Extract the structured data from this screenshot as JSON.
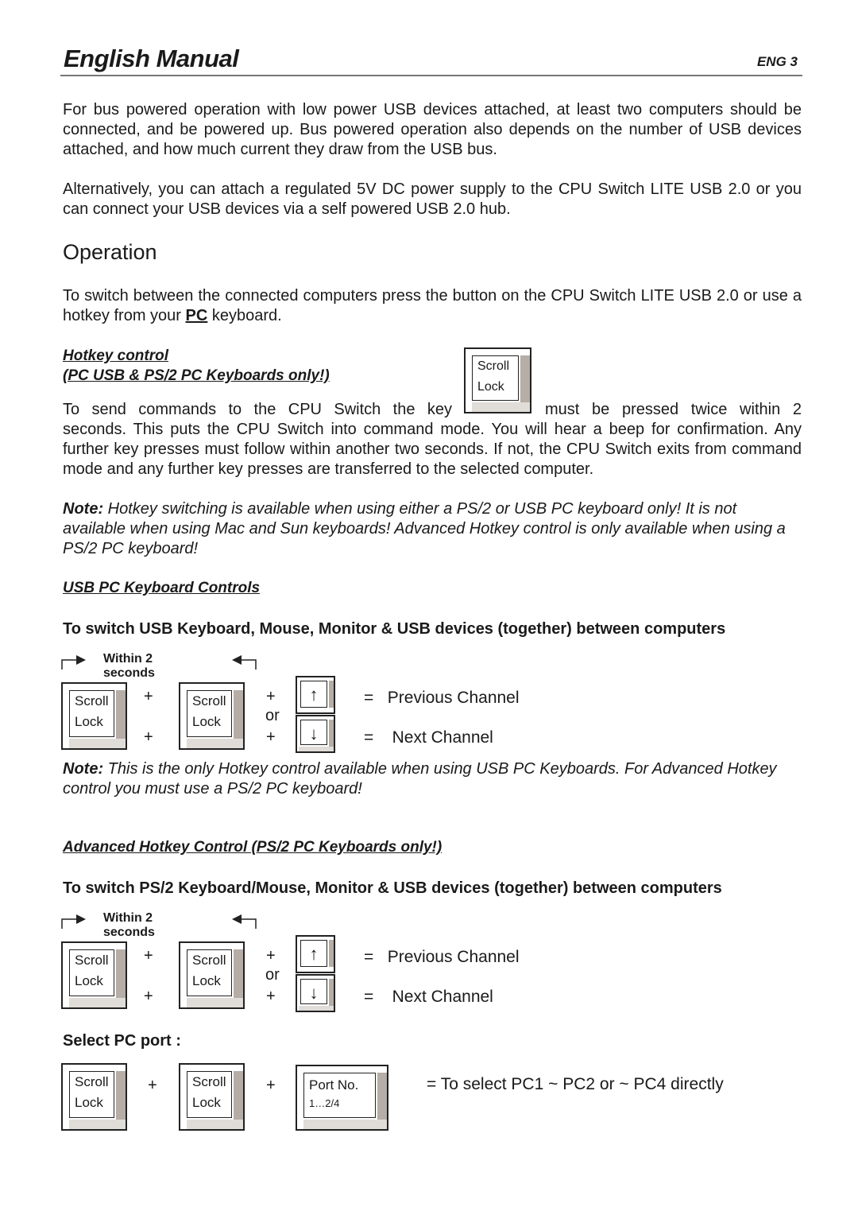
{
  "header": {
    "title": "English Manual",
    "page": "ENG 3"
  },
  "intro": [
    "For bus powered operation with low power USB devices attached, at least two computers should be connected, and be powered up. Bus powered operation also depends on the number of USB devices attached, and how much current they draw from the USB bus.",
    "Alternatively, you can attach a regulated 5V DC power supply to the CPU Switch LITE USB 2.0 or you can connect your USB devices via a self powered USB 2.0 hub."
  ],
  "operation": {
    "heading": "Operation",
    "text_before": "To switch between the connected computers press the button on the CPU Switch LITE USB 2.0 or use a hotkey from your ",
    "text_pc": "PC",
    "text_after": " keyboard."
  },
  "hotkey": {
    "title1": "Hotkey control",
    "title2": "(PC USB & PS/2 PC Keyboards only!)",
    "line1_a": "To send commands to the CPU Switch the key",
    "line1_b": "must be pressed twice within 2",
    "rest": "seconds. This puts the CPU Switch into command mode. You will hear a beep for confirmation. Any further key presses must follow within another two seconds. If not, the CPU Switch exits from command mode and any further key presses are transferred to the selected computer."
  },
  "note1": {
    "label": "Note:",
    "text": "  Hotkey switching is available when using either a PS/2 or USB PC keyboard only! It is not available when using Mac and Sun keyboards! Advanced Hotkey control is only available when using a PS/2 PC keyboard!"
  },
  "usb_section": {
    "title": "USB PC Keyboard Controls",
    "subtitle": "To switch USB Keyboard, Mouse, Monitor & USB devices (together) between computers"
  },
  "note2": {
    "label": "Note:",
    "text": " This is the only Hotkey control available when using USB PC Keyboards. For Advanced Hotkey control you must use a PS/2 PC keyboard!"
  },
  "adv_section": {
    "title": "Advanced Hotkey Control (PS/2 PC Keyboards only!)",
    "subtitle": "To switch PS/2 Keyboard/Mouse, Monitor & USB devices (together) between computers"
  },
  "diagram": {
    "within": "Within 2 seconds",
    "key1": "Scroll",
    "key2": "Lock",
    "plus": "+",
    "or": "or",
    "up": "↑",
    "down": "↓",
    "prev": "=   Previous Channel",
    "next": "=    Next Channel"
  },
  "select_port": {
    "title": "Select PC port :",
    "port_key1": "Port No.",
    "port_key2": "1…2/4",
    "result": "=  To select PC1 ~ PC2 or ~ PC4 directly"
  }
}
